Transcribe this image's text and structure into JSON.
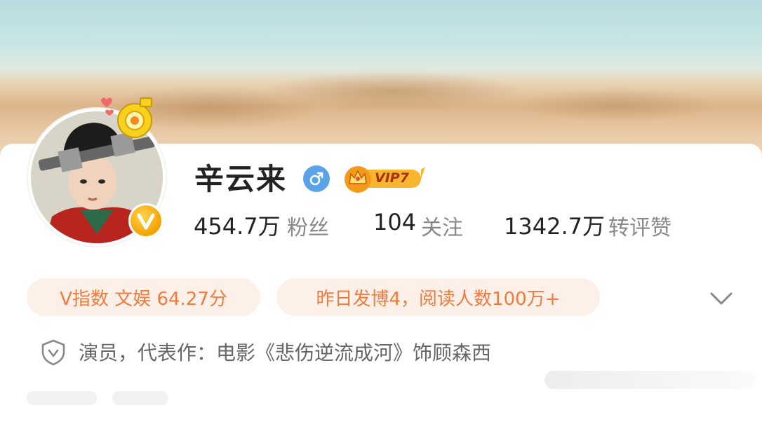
{
  "profile": {
    "name": "辛云来",
    "vip_label": "VIP7",
    "stats": [
      {
        "value": "454.7万",
        "label": "粉丝"
      },
      {
        "value": "104",
        "label": "关注"
      },
      {
        "value": "1342.7万",
        "label": "转评赞"
      }
    ],
    "v_index": "V指数 文娱 64.27分",
    "posting_info": "昨日发博4，阅读人数100万+",
    "bio": "演员，代表作：电影《悲伤逆流成河》饰顾森西"
  },
  "icons": {
    "gender": "male-icon",
    "verified": "v-verified-icon",
    "vip": "crown-icon",
    "expand": "chevron-down-icon",
    "bio": "shield-icon",
    "pendant": "camera-charm-icon"
  },
  "colors": {
    "accent_orange": "#f07b3f",
    "pill_bg": "#fdf0e9",
    "male_blue": "#5aa3e8",
    "vip_gold": "#f5a623",
    "verified_gold": "#f4a200"
  }
}
